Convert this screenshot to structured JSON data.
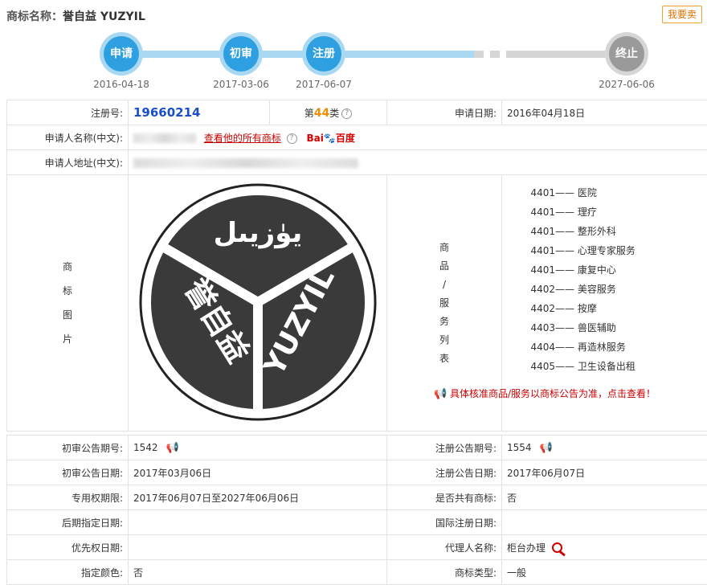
{
  "header": {
    "label": "商标名称：",
    "name": "誉自益 YUZYIL",
    "sell_button": "我要卖"
  },
  "timeline": [
    {
      "label": "申请",
      "date": "2016-04-18",
      "status": "done"
    },
    {
      "label": "初审",
      "date": "2017-03-06",
      "status": "done"
    },
    {
      "label": "注册",
      "date": "2017-06-07",
      "status": "done"
    },
    {
      "label": "终止",
      "date": "2027-06-06",
      "status": "future"
    }
  ],
  "colors": {
    "accent": "#2e9fe0",
    "accent_light": "#a9d8f2",
    "future": "#9a9a9a",
    "link_red": "#c80000",
    "regno_blue": "#1a4fc7",
    "class_orange": "#f08c00"
  },
  "info": {
    "reg_no_label": "注册号:",
    "reg_no": "19660214",
    "class_prefix": "第",
    "class_num": "44",
    "class_suffix": "类",
    "apply_date_label": "申请日期:",
    "apply_date": "2016年04月18日",
    "applicant_name_label": "申请人名称(中文):",
    "view_all_link": "查看他的所有商标",
    "baidu_text": "Bai",
    "baidu_text2": "百度",
    "applicant_addr_label": "申请人地址(中文):",
    "image_label": [
      "商",
      "标",
      "图",
      "片"
    ],
    "goods_label": [
      "商",
      "品",
      "/",
      "服",
      "务",
      "列",
      "表"
    ],
    "goods": [
      {
        "code": "4401",
        "name": "医院"
      },
      {
        "code": "4401",
        "name": "理疗"
      },
      {
        "code": "4401",
        "name": "整形外科"
      },
      {
        "code": "4401",
        "name": "心理专家服务"
      },
      {
        "code": "4401",
        "name": "康复中心"
      },
      {
        "code": "4402",
        "name": "美容服务"
      },
      {
        "code": "4402",
        "name": "按摩"
      },
      {
        "code": "4403",
        "name": "兽医辅助"
      },
      {
        "code": "4404",
        "name": "再造林服务"
      },
      {
        "code": "4405",
        "name": "卫生设备出租"
      }
    ],
    "goods_notice": "具体核准商品/服务以商标公告为准，点击查看！",
    "logo_top": "يۈزيىل",
    "logo_left": "誉自益",
    "logo_right": "YUZYIL"
  },
  "rows": [
    {
      "k1": "初审公告期号:",
      "v1": "1542",
      "k2": "注册公告期号:",
      "v2": "1554"
    },
    {
      "k1": "初审公告日期:",
      "v1": "2017年03月06日",
      "k2": "注册公告日期:",
      "v2": "2017年06月07日"
    },
    {
      "k1": "专用权期限:",
      "v1": "2017年06月07日至2027年06月06日",
      "k2": "是否共有商标:",
      "v2": "否"
    },
    {
      "k1": "后期指定日期:",
      "v1": "",
      "k2": "国际注册日期:",
      "v2": ""
    },
    {
      "k1": "优先权日期:",
      "v1": "",
      "k2": "代理人名称:",
      "v2": "柜台办理"
    },
    {
      "k1": "指定颜色:",
      "v1": "否",
      "k2": "商标类型:",
      "v2": "一般"
    }
  ]
}
